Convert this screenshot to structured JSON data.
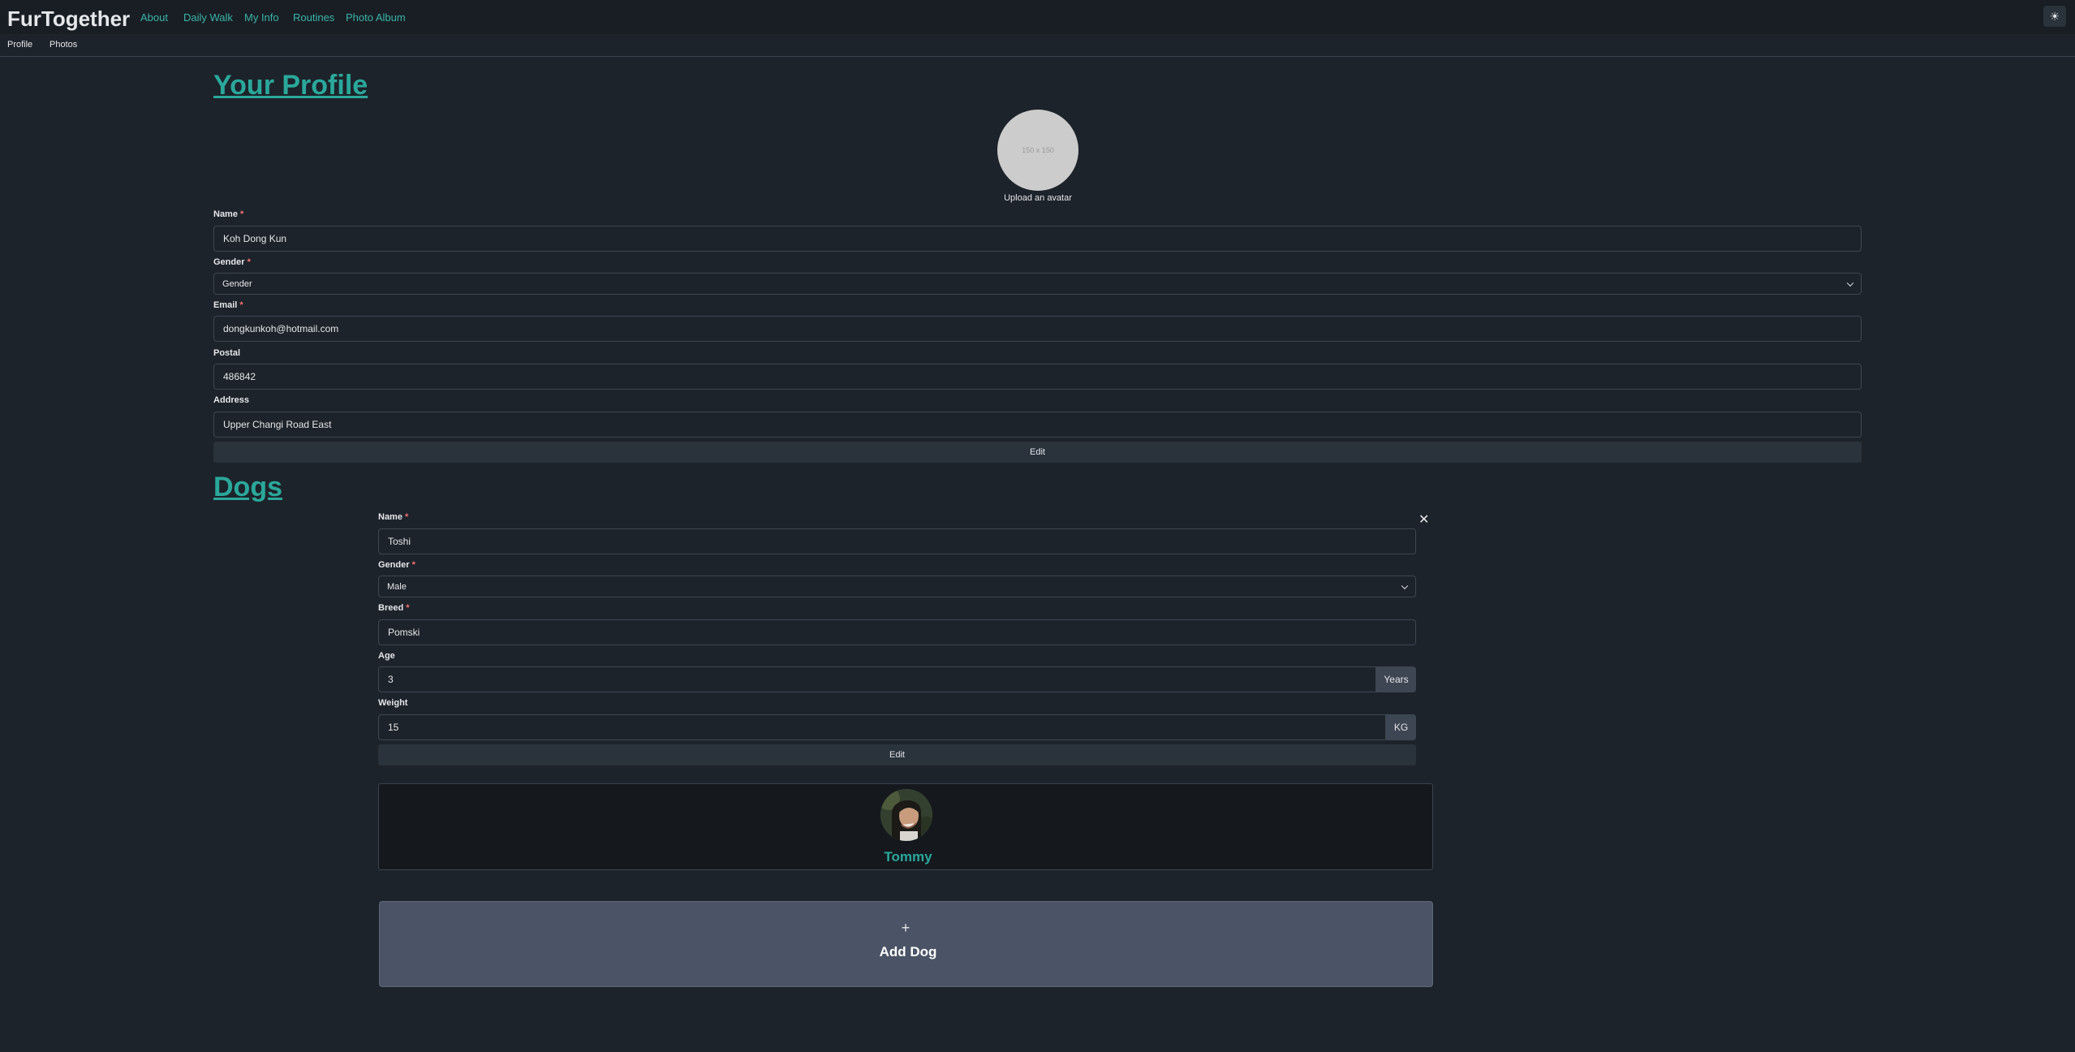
{
  "app": {
    "brand": "FurTogether",
    "nav": [
      "About",
      "Daily Walk",
      "My Info",
      "Routines",
      "Photo Album"
    ],
    "theme_icon": "sun-icon"
  },
  "subnav": [
    "Profile",
    "Photos"
  ],
  "profile": {
    "title": "Your Profile",
    "avatar_placeholder": "150 x 150",
    "upload_text": "Upload an avatar",
    "fields": {
      "name_label": "Name",
      "name_value": "Koh Dong Kun",
      "gender_label": "Gender",
      "gender_value": "Gender",
      "email_label": "Email",
      "email_value": "dongkunkoh@hotmail.com",
      "postal_label": "Postal",
      "postal_value": "486842",
      "address_label": "Address",
      "address_value": "Upper Changi Road East"
    },
    "edit_label": "Edit"
  },
  "dogs": {
    "title": "Dogs",
    "close_icon": "close-icon",
    "form": {
      "name_label": "Name",
      "name_value": "Toshi",
      "gender_label": "Gender",
      "gender_value": "Male",
      "breed_label": "Breed",
      "breed_value": "Pomski",
      "age_label": "Age",
      "age_value": "3",
      "age_unit": "Years",
      "weight_label": "Weight",
      "weight_value": "15",
      "weight_unit": "KG",
      "edit_label": "Edit"
    },
    "cards": [
      {
        "name": "Tommy"
      }
    ],
    "add": {
      "icon": "+",
      "label": "Add Dog"
    }
  },
  "required_marker": "*",
  "colors": {
    "accent": "#2aa89b",
    "background": "#1d232a",
    "navbar": "#191e24",
    "required": "#f87272"
  }
}
